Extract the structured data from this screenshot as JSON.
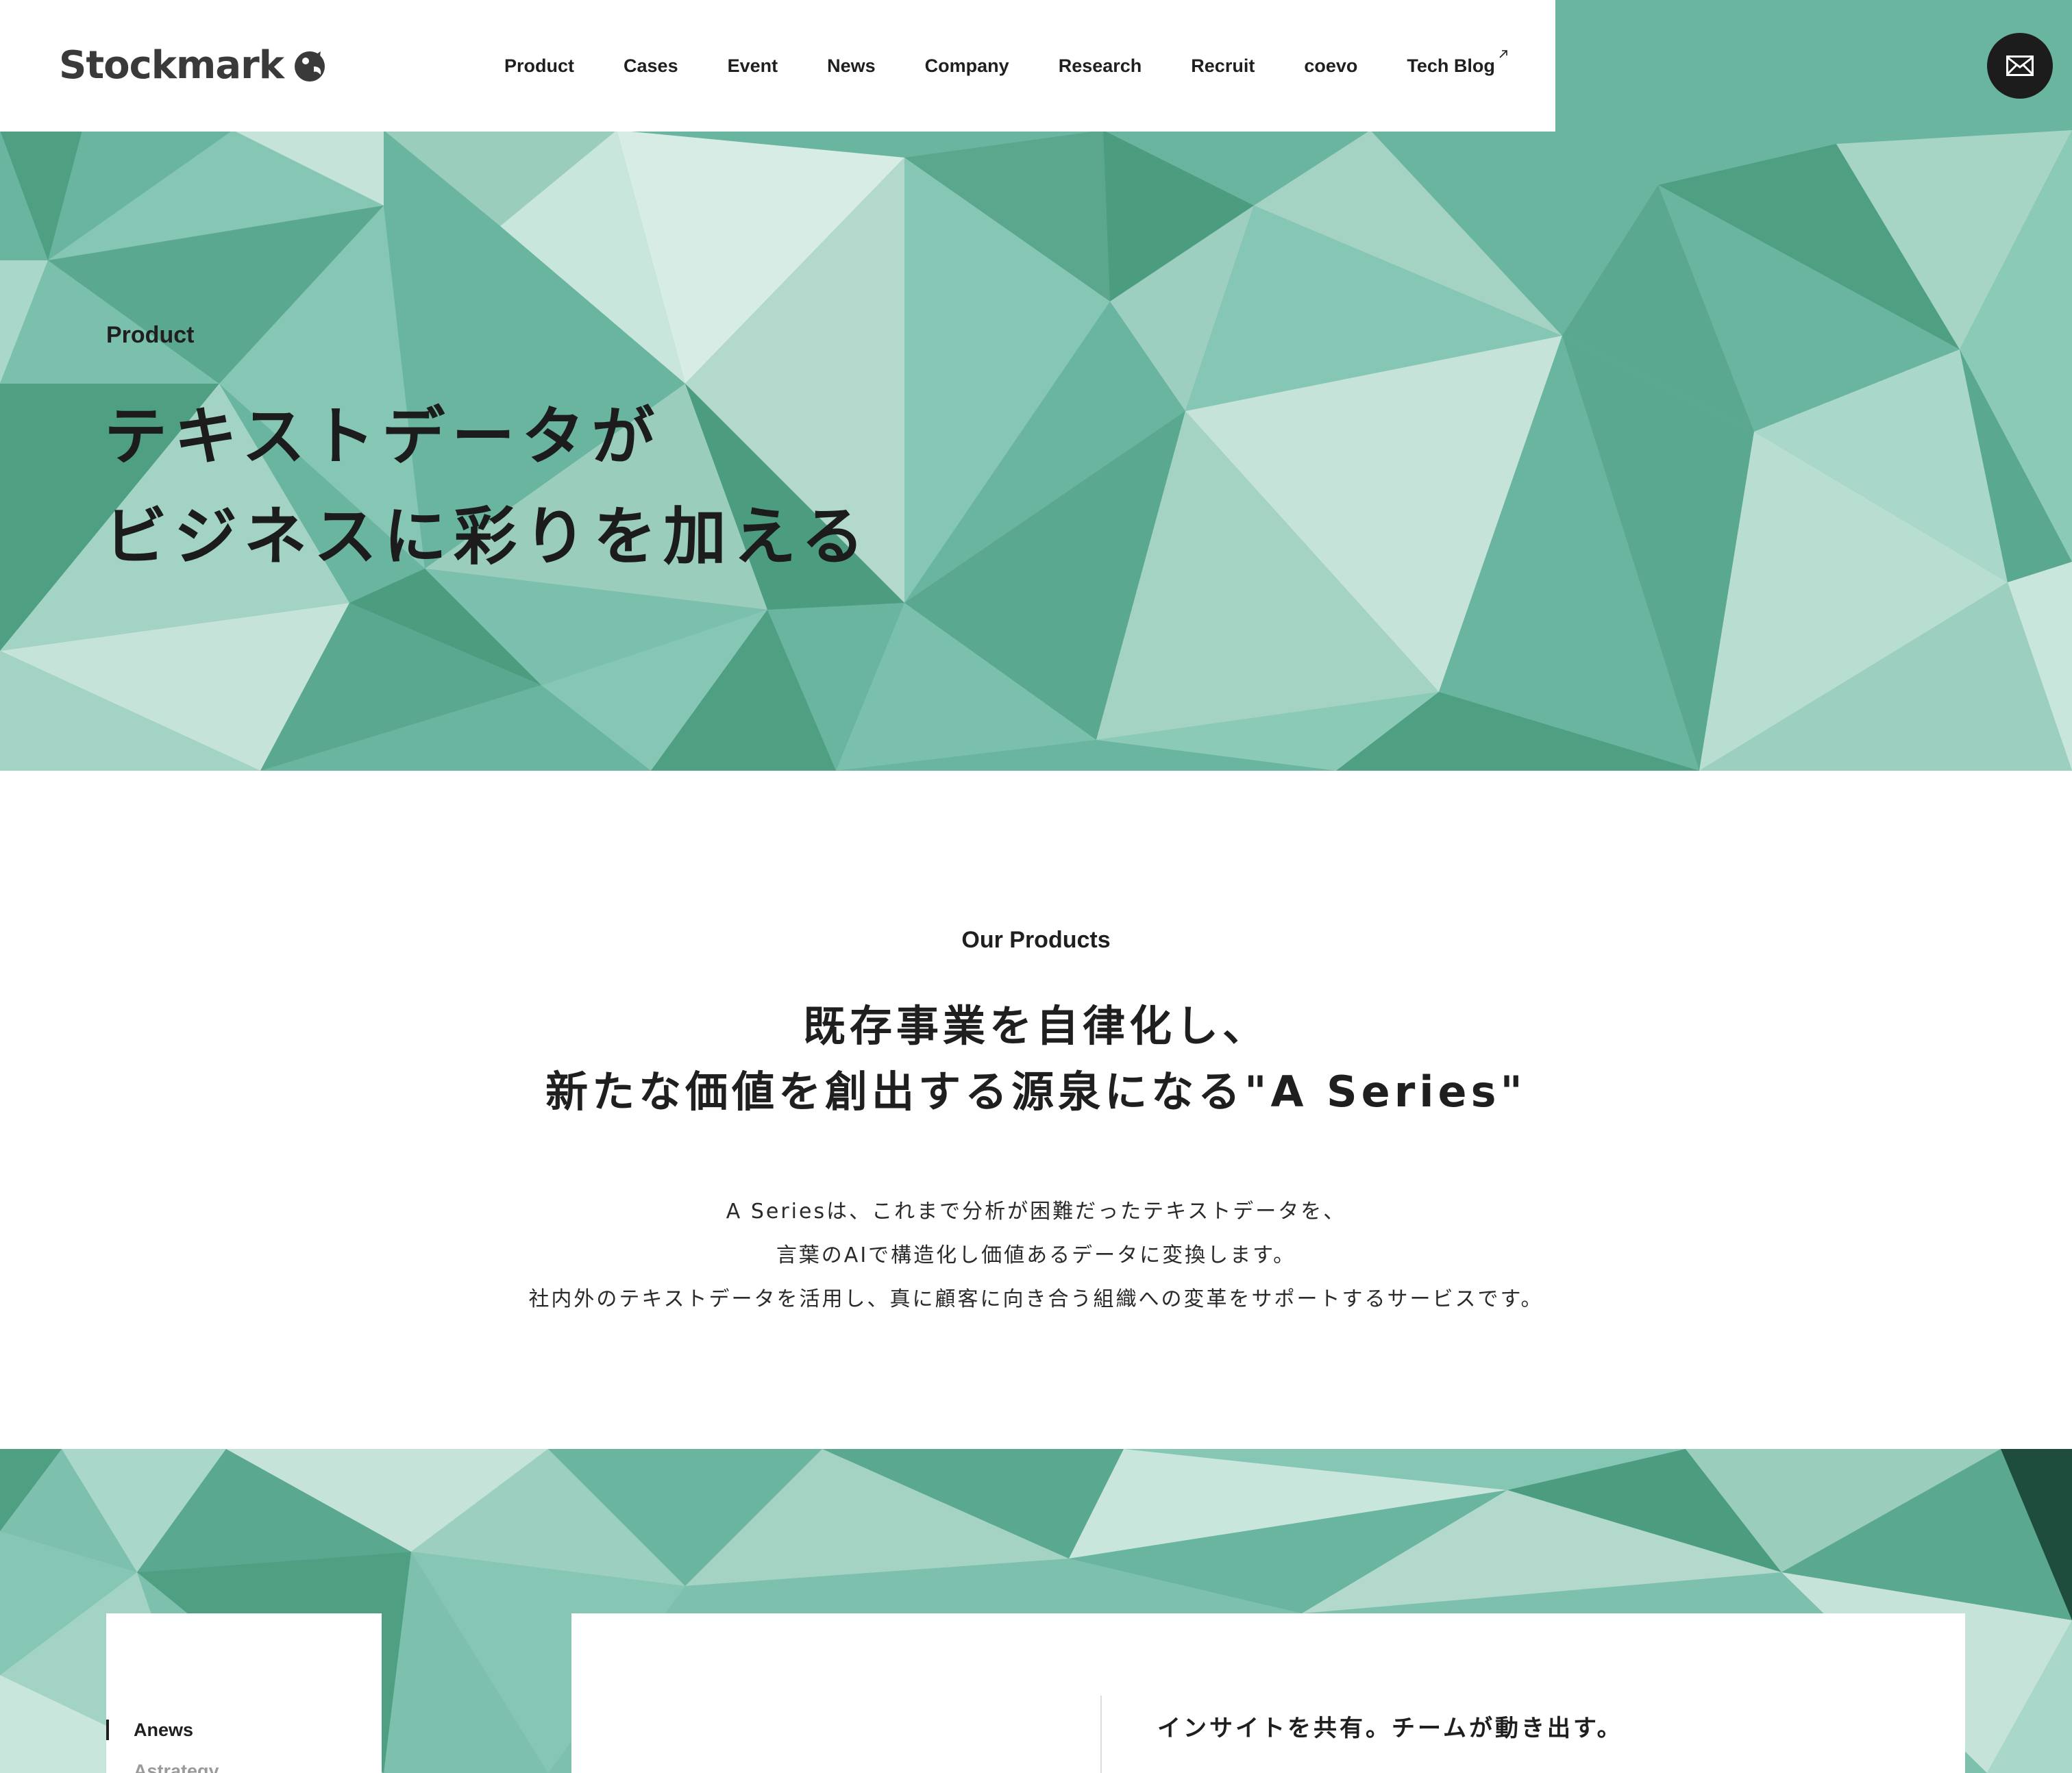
{
  "header": {
    "logo_text": "Stockmark",
    "nav": [
      {
        "label": "Product"
      },
      {
        "label": "Cases"
      },
      {
        "label": "Event"
      },
      {
        "label": "News"
      },
      {
        "label": "Company"
      },
      {
        "label": "Research"
      },
      {
        "label": "Recruit"
      },
      {
        "label": "coevo"
      },
      {
        "label": "Tech Blog",
        "external": true
      }
    ],
    "contact_icon": "mail-icon"
  },
  "hero": {
    "label": "Product",
    "title_lines": [
      "テキストデータが",
      "ビジネスに彩りを加える"
    ]
  },
  "products": {
    "label": "Our Products",
    "title_lines": [
      "既存事業を自律化し、",
      "新たな価値を創出する源泉になる\"A Series\""
    ],
    "description_lines": [
      "A Seriesは、これまで分析が困難だったテキストデータを、",
      "言葉のAIで構造化し価値あるデータに変換します。",
      "社内外のテキストデータを活用し、真に顧客に向き合う組織への変革をサポートするサービスです。"
    ]
  },
  "product_tabs": {
    "items": [
      {
        "label": "Anews",
        "active": true
      },
      {
        "label": "Astrategy",
        "active": false
      }
    ]
  },
  "product_detail": {
    "heading": "インサイトを共有。チームが動き出す。"
  },
  "colors": {
    "accent_green": "#6ab5a0",
    "dark": "#1c1c1c",
    "logo_gray": "#3a3a3a"
  }
}
